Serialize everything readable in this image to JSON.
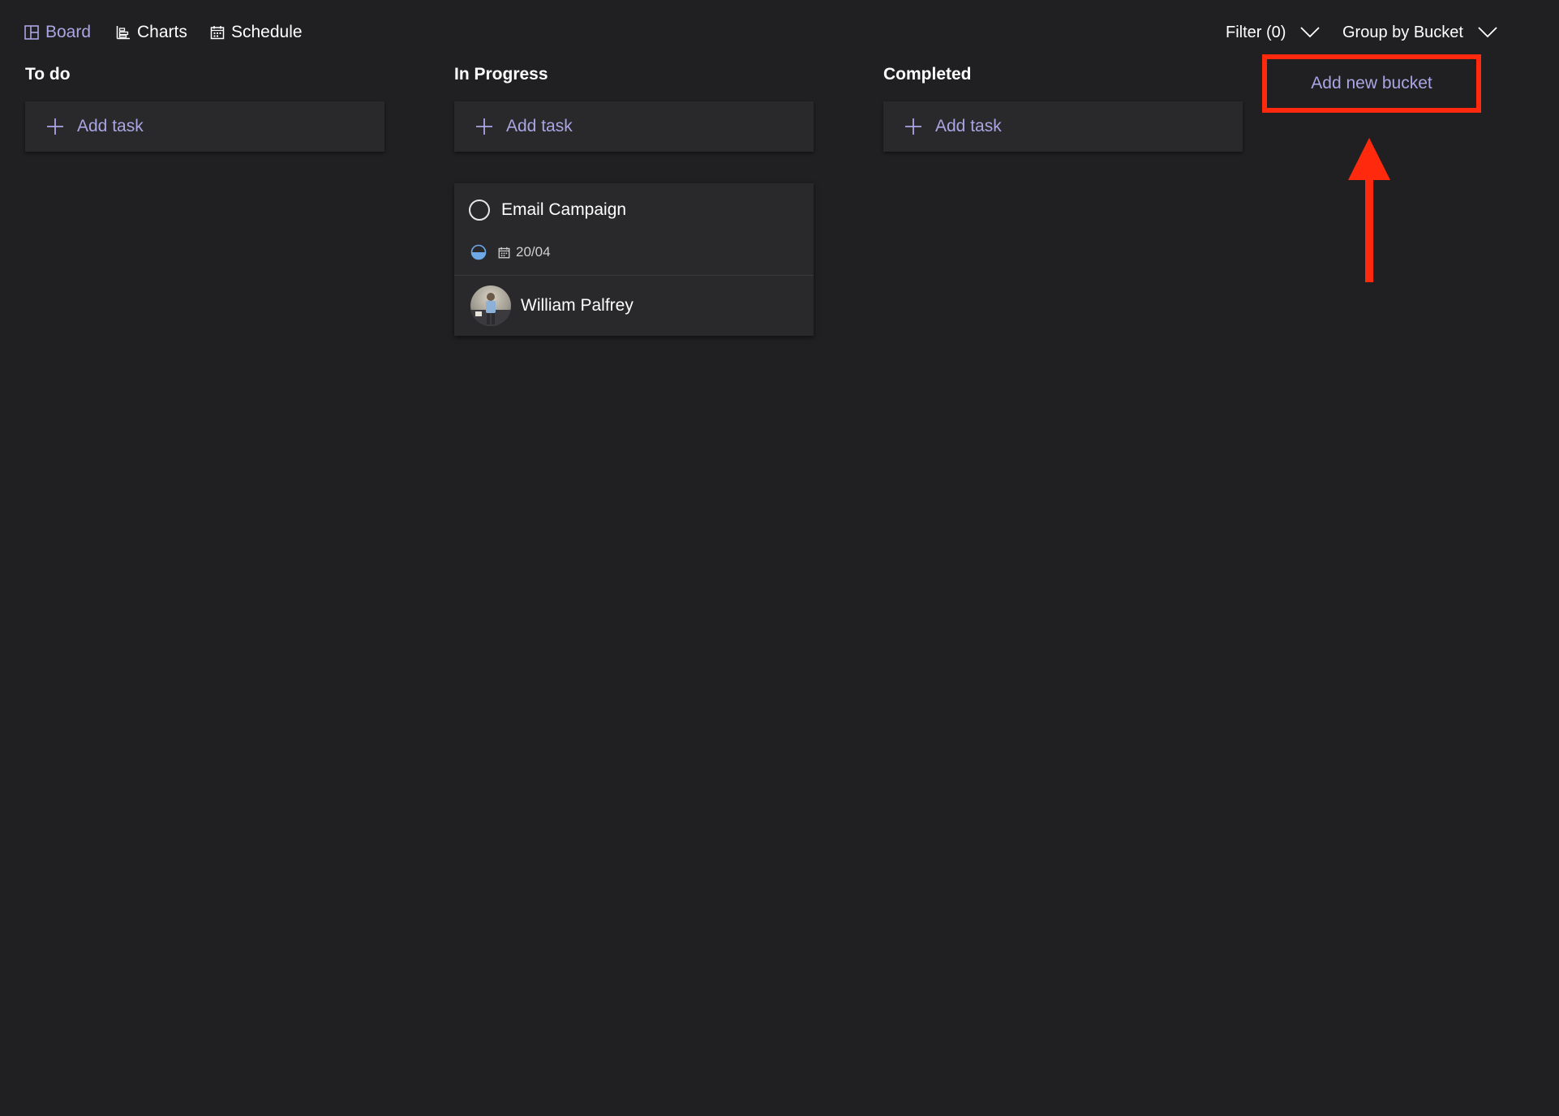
{
  "nav": {
    "board": "Board",
    "charts": "Charts",
    "schedule": "Schedule"
  },
  "controls": {
    "filter": "Filter (0)",
    "group_by": "Group by Bucket"
  },
  "buckets": [
    {
      "title": "To do",
      "add_task": "Add task"
    },
    {
      "title": "In Progress",
      "add_task": "Add task"
    },
    {
      "title": "Completed",
      "add_task": "Add task"
    }
  ],
  "task": {
    "title": "Email Campaign",
    "progress": 0.5,
    "due_date": "20/04",
    "assignee": "William Palfrey"
  },
  "add_bucket": "Add new bucket",
  "colors": {
    "background": "#201f21",
    "card": "#29282a",
    "accent": "#a9a6e3",
    "progress": "#6ea8e6",
    "annotation": "#ff2a0d"
  },
  "icons": {
    "board": "board-icon",
    "charts": "charts-icon",
    "schedule": "calendar-icon",
    "filter": "chevron-down-icon",
    "group": "chevron-down-icon",
    "add": "plus-icon",
    "complete": "circle-check-icon",
    "progress": "half-circle-progress-icon",
    "due": "calendar-icon"
  }
}
